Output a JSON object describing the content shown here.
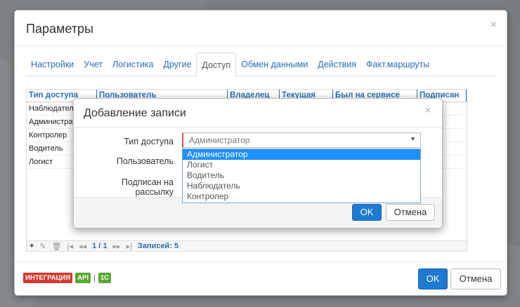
{
  "main_dialog": {
    "title": "Параметры",
    "close_glyph": "×",
    "tabs": [
      "Настройки",
      "Учет",
      "Логистика",
      "Другие",
      "Доступ",
      "Обмен данными",
      "Действия",
      "Факт.маршруты"
    ],
    "active_tab": "Доступ",
    "grid": {
      "columns": [
        "Тип доступа",
        "Пользователь",
        "Владелец",
        "Текущая",
        "Был на сервисе",
        "Подписан"
      ],
      "rows": [
        [
          "Наблюдатель"
        ],
        [
          "Администратор"
        ],
        [
          "Контролер"
        ],
        [
          "Водитель"
        ],
        [
          "Логист"
        ]
      ]
    },
    "grid_footer": {
      "add": "+",
      "edit": "✎",
      "delete": "🗑",
      "first": "|◂",
      "prev": "◂◂",
      "page": "1 / 1",
      "next": "▸▸",
      "last": "▸|",
      "records": "Записей: 5"
    },
    "badges": {
      "integration": "ИНТЕГРАЦИЯ",
      "api": "API",
      "separator": "|",
      "onec": "1С"
    },
    "ok_label": "OK",
    "cancel_label": "Отмена"
  },
  "add_dialog": {
    "title": "Добавление записи",
    "close_glyph": "×",
    "labels": {
      "access_type": "Тип доступа",
      "user": "Пользователь",
      "subscribed": "Подписан на рассылку"
    },
    "select_value": "Администратор",
    "options": [
      "Администратор",
      "Логист",
      "Водитель",
      "Наблюдатель",
      "Контролер"
    ],
    "selected_option": "Администратор",
    "ok_label": "OK",
    "cancel_label": "Отмена"
  },
  "colors": {
    "link_blue": "#2a6db5",
    "primary_button": "#1e7ad0",
    "selection": "#1e90ff",
    "required_red": "#d9534f",
    "badge_red": "#d43a2f",
    "badge_green": "#5aa832"
  }
}
